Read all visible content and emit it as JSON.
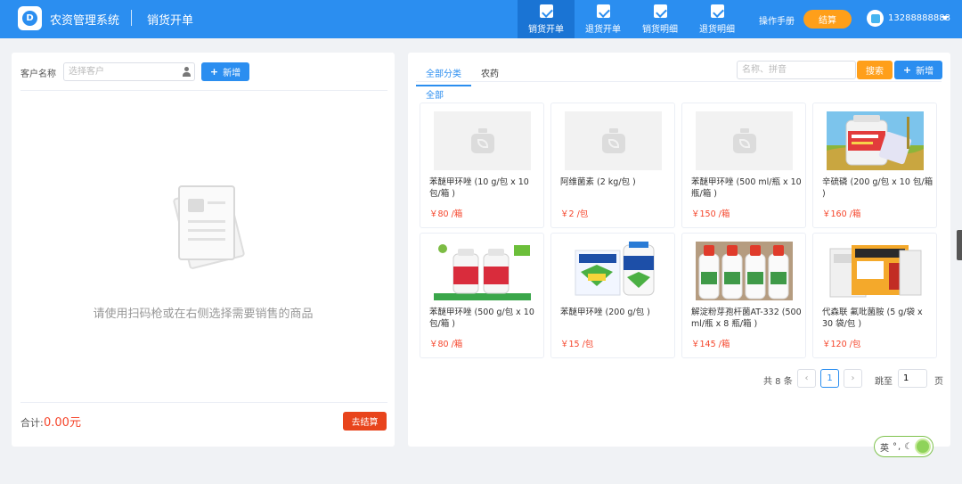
{
  "header": {
    "app_title": "农资管理系统",
    "page_title": "销货开单",
    "nav": [
      {
        "label": "销货开单",
        "active": true
      },
      {
        "label": "退货开单",
        "active": false
      },
      {
        "label": "销货明细",
        "active": false
      },
      {
        "label": "退货明细",
        "active": false
      }
    ],
    "manual_label": "操作手册",
    "settle_label": "结算",
    "user_phone": "13288888888",
    "brand_color": "#2b8ef0"
  },
  "left": {
    "customer_label": "客户名称",
    "customer_placeholder": "选择客户",
    "add_label": "新增",
    "empty_text": "请使用扫码枪或在右侧选择需要销售的商品",
    "total_label": "合计:",
    "total_value": "0.00元",
    "checkout_label": "去结算"
  },
  "right": {
    "tabs": [
      "全部分类",
      "农药"
    ],
    "search_placeholder": "名称、拼音",
    "search_label": "搜索",
    "add_label": "新增",
    "subcategory": "全部",
    "products": [
      {
        "name": "苯醚甲环唑 (10 g/包 x 10 包/箱 )",
        "price": "￥80 /箱",
        "image": "placeholder"
      },
      {
        "name": "阿维菌素 (2 kg/包 )",
        "price": "￥2 /包",
        "image": "placeholder"
      },
      {
        "name": "苯醚甲环唑 (500 ml/瓶 x 10 瓶/箱 )",
        "price": "￥150 /箱",
        "image": "placeholder"
      },
      {
        "name": "辛硫磷 (200 g/包 x 10 包/箱 )",
        "price": "￥160 /箱",
        "image": "photo-bottle-field"
      },
      {
        "name": "苯醚甲环唑 (500 g/包 x 10 包/箱 )",
        "price": "￥80 /箱",
        "image": "photo-two-bottles"
      },
      {
        "name": "苯醚甲环唑 (200 g/包 )",
        "price": "￥15 /包",
        "image": "photo-bag-bottle"
      },
      {
        "name": "解淀粉芽孢杆菌AT-332 (500 ml/瓶 x 8 瓶/箱 )",
        "price": "￥145 /箱",
        "image": "photo-four-bottles"
      },
      {
        "name": "代森联 氟吡菌胺 (5 g/袋 x 30 袋/包 )",
        "price": "￥120 /包",
        "image": "photo-packets"
      }
    ],
    "pager": {
      "total": "共 8 条",
      "current_page": "1",
      "jump_label": "跳至",
      "jump_value": "1",
      "page_suffix": "页",
      "prev_icon": "‹",
      "next_icon": "›"
    }
  },
  "ime": {
    "lang": "英"
  },
  "colors": {
    "accent": "#2b8ef0",
    "orange": "#ff9f1a",
    "danger": "#e8441c",
    "price": "#f5442a"
  }
}
